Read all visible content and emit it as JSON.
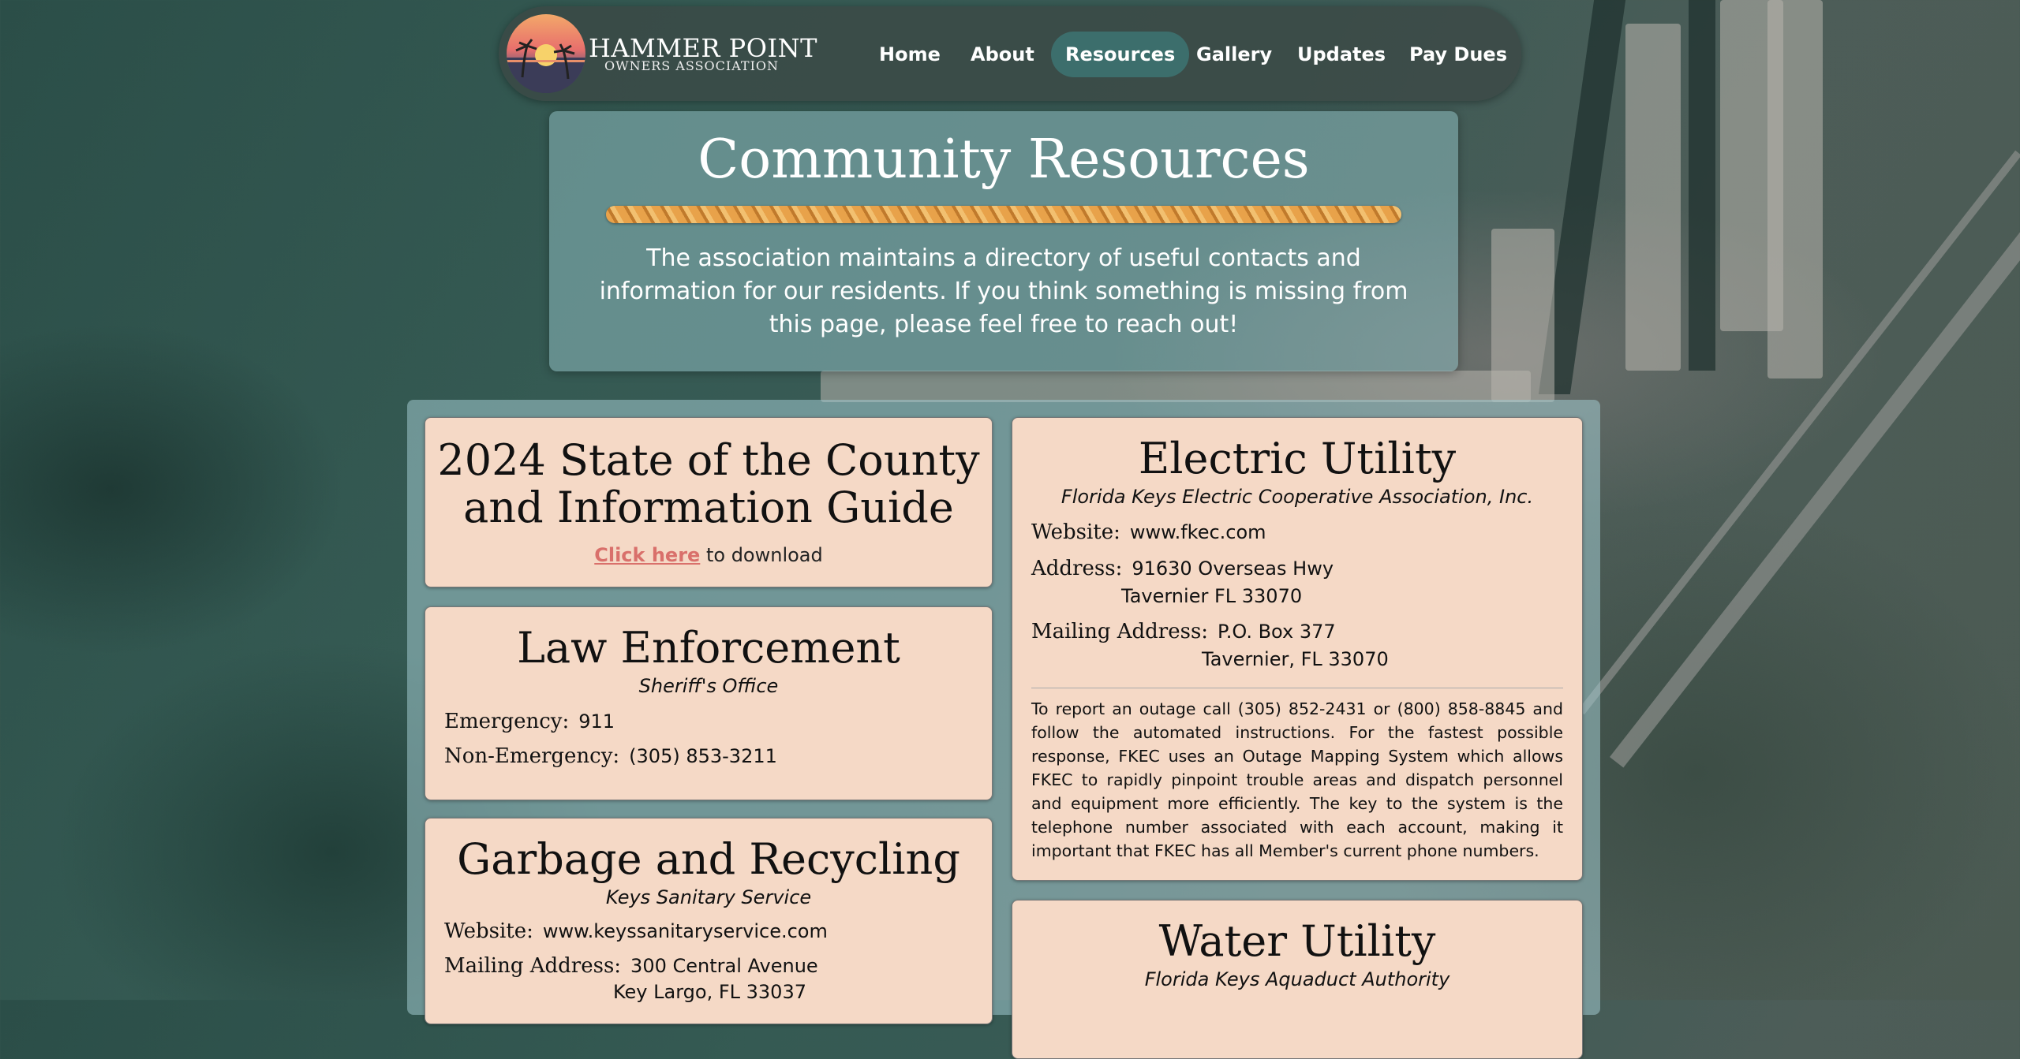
{
  "brand": {
    "title": "HAMMER POINT",
    "subtitle": "OWNERS ASSOCIATION"
  },
  "nav": {
    "items": [
      {
        "label": "Home"
      },
      {
        "label": "About"
      },
      {
        "label": "Resources",
        "active": true
      },
      {
        "label": "Gallery"
      },
      {
        "label": "Updates"
      },
      {
        "label": "Pay Dues"
      }
    ]
  },
  "hero": {
    "title": "Community Resources",
    "text": "The association maintains a directory of useful contacts and information for our residents. If you think something is missing from this page, please feel free to reach out!"
  },
  "guide": {
    "title_line1": "2024 State of the County",
    "title_line2": "and Information Guide",
    "link": "Click here",
    "link_suffix": "to download"
  },
  "law": {
    "title": "Law Enforcement",
    "subtitle": "Sheriff's Office",
    "emergency_label": "Emergency:",
    "emergency_value": "911",
    "nonemergency_label": "Non-Emergency:",
    "nonemergency_value": "(305) 853-3211"
  },
  "garbage": {
    "title": "Garbage and Recycling",
    "subtitle": "Keys Sanitary Service",
    "website_label": "Website:",
    "website_value": "www.keyssanitaryservice.com",
    "mailing_label": "Mailing Address:",
    "mailing_line1": "300 Central Avenue",
    "mailing_line2": "Key Largo, FL 33037"
  },
  "electric": {
    "title": "Electric Utility",
    "subtitle": "Florida Keys Electric Cooperative Association, Inc.",
    "website_label": "Website:",
    "website_value": "www.fkec.com",
    "address_label": "Address:",
    "address_line1": "91630 Overseas Hwy",
    "address_line2": "Tavernier FL 33070",
    "mailing_label": "Mailing Address:",
    "mailing_line1": "P.O. Box 377",
    "mailing_line2": "Tavernier, FL 33070",
    "outage_text": "To report an outage call (305) 852-2431 or (800) 858-8845 and follow the automated instructions. For the fastest possible response, FKEC uses an Outage Mapping System which allows FKEC to rapidly pinpoint trouble areas and dispatch personnel and equipment more efficiently. The key to the system is the telephone number associated with each account, making it important that FKEC has all Member's current phone numbers."
  },
  "water": {
    "title": "Water Utility",
    "subtitle": "Florida Keys Aquaduct Authority"
  },
  "colors": {
    "card_bg": "#f5d9c6",
    "nav_active": "#3c6e6c",
    "link": "#d9706b",
    "rope": "#e8a24a"
  }
}
